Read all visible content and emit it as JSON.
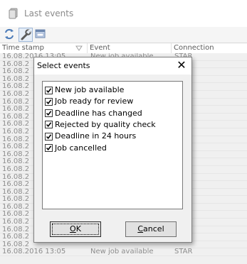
{
  "window": {
    "title": "Last events",
    "app_icon": "document-stack-icon"
  },
  "toolbar": {
    "buttons": [
      {
        "icon": "refresh-icon"
      },
      {
        "icon": "wrench-icon"
      },
      {
        "icon": "window-icon"
      }
    ]
  },
  "grid": {
    "columns": [
      "Time stamp",
      "Event",
      "Connection"
    ],
    "rows": [
      {
        "time": "16.08.2016 13:05",
        "event": "New job available",
        "connection": "STAR"
      },
      {
        "time": "16.08.2",
        "event": "",
        "connection": ""
      },
      {
        "time": "16.08.2",
        "event": "",
        "connection": ""
      },
      {
        "time": "16.08.2",
        "event": "",
        "connection": ""
      },
      {
        "time": "16.08.2",
        "event": "",
        "connection": ""
      },
      {
        "time": "16.08.2",
        "event": "",
        "connection": ""
      },
      {
        "time": "16.08.2",
        "event": "",
        "connection": ""
      },
      {
        "time": "16.08.2",
        "event": "",
        "connection": ""
      },
      {
        "time": "16.08.2",
        "event": "",
        "connection": ""
      },
      {
        "time": "16.08.2",
        "event": "",
        "connection": ""
      },
      {
        "time": "16.08.2",
        "event": "",
        "connection": ""
      },
      {
        "time": "16.08.2",
        "event": "",
        "connection": ""
      },
      {
        "time": "16.08.2",
        "event": "",
        "connection": ""
      },
      {
        "time": "16.08.2",
        "event": "",
        "connection": ""
      },
      {
        "time": "16.08.2",
        "event": "",
        "connection": ""
      },
      {
        "time": "16.08.2",
        "event": "",
        "connection": ""
      },
      {
        "time": "16.08.2",
        "event": "",
        "connection": ""
      },
      {
        "time": "16.08.2",
        "event": "",
        "connection": ""
      },
      {
        "time": "16.08.2",
        "event": "",
        "connection": ""
      },
      {
        "time": "16.08.2",
        "event": "",
        "connection": ""
      },
      {
        "time": "16.08.2",
        "event": "",
        "connection": ""
      },
      {
        "time": "16.08.2",
        "event": "",
        "connection": ""
      },
      {
        "time": "16.08.2",
        "event": "",
        "connection": ""
      },
      {
        "time": "16.08.2",
        "event": "",
        "connection": ""
      },
      {
        "time": "16.08.2",
        "event": "",
        "connection": ""
      },
      {
        "time": "16.08.2",
        "event": "",
        "connection": ""
      },
      {
        "time": "16.08.2016 13:05",
        "event": "New job available",
        "connection": "STAR"
      }
    ]
  },
  "dialog": {
    "title": "Select events",
    "close_glyph": "✕",
    "items": [
      {
        "label": "New job available",
        "checked": true
      },
      {
        "label": "Job ready for review",
        "checked": true
      },
      {
        "label": "Deadline has changed",
        "checked": true
      },
      {
        "label": "Rejected by quality check",
        "checked": true
      },
      {
        "label": "Deadline in 24 hours",
        "checked": true
      },
      {
        "label": "Job cancelled",
        "checked": true
      }
    ],
    "ok_accel": "O",
    "ok_rest": "K",
    "cancel_accel": "C",
    "cancel_rest": "ancel"
  }
}
